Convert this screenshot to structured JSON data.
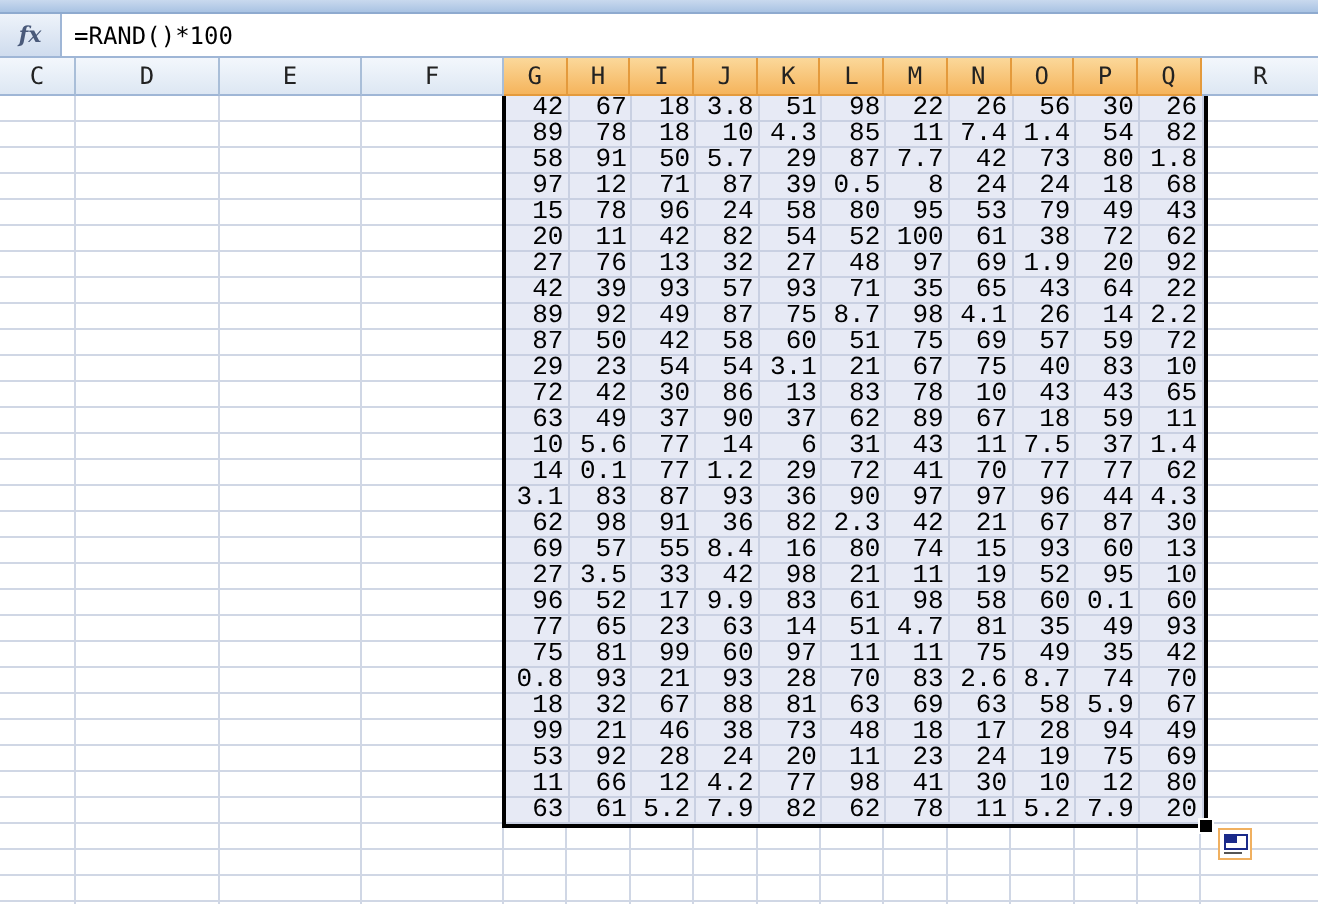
{
  "formula_bar": {
    "function_label": "fx",
    "formula": "=RAND()*100"
  },
  "columns": [
    {
      "label": "C",
      "selected": false
    },
    {
      "label": "D",
      "selected": false
    },
    {
      "label": "E",
      "selected": false
    },
    {
      "label": "F",
      "selected": false
    },
    {
      "label": "G",
      "selected": true
    },
    {
      "label": "H",
      "selected": true
    },
    {
      "label": "I",
      "selected": true
    },
    {
      "label": "J",
      "selected": true
    },
    {
      "label": "K",
      "selected": true
    },
    {
      "label": "L",
      "selected": true
    },
    {
      "label": "M",
      "selected": true
    },
    {
      "label": "N",
      "selected": true
    },
    {
      "label": "O",
      "selected": true
    },
    {
      "label": "P",
      "selected": true
    },
    {
      "label": "Q",
      "selected": true
    },
    {
      "label": "R",
      "selected": false
    }
  ],
  "rows": [
    [
      "42",
      "67",
      "18",
      "3.8",
      "51",
      "98",
      "22",
      "26",
      "56",
      "30",
      "26"
    ],
    [
      "89",
      "78",
      "18",
      "10",
      "4.3",
      "85",
      "11",
      "7.4",
      "1.4",
      "54",
      "82"
    ],
    [
      "58",
      "91",
      "50",
      "5.7",
      "29",
      "87",
      "7.7",
      "42",
      "73",
      "80",
      "1.8"
    ],
    [
      "97",
      "12",
      "71",
      "87",
      "39",
      "0.5",
      "8",
      "24",
      "24",
      "18",
      "68"
    ],
    [
      "15",
      "78",
      "96",
      "24",
      "58",
      "80",
      "95",
      "53",
      "79",
      "49",
      "43"
    ],
    [
      "20",
      "11",
      "42",
      "82",
      "54",
      "52",
      "100",
      "61",
      "38",
      "72",
      "62"
    ],
    [
      "27",
      "76",
      "13",
      "32",
      "27",
      "48",
      "97",
      "69",
      "1.9",
      "20",
      "92"
    ],
    [
      "42",
      "39",
      "93",
      "57",
      "93",
      "71",
      "35",
      "65",
      "43",
      "64",
      "22"
    ],
    [
      "89",
      "92",
      "49",
      "87",
      "75",
      "8.7",
      "98",
      "4.1",
      "26",
      "14",
      "2.2"
    ],
    [
      "87",
      "50",
      "42",
      "58",
      "60",
      "51",
      "75",
      "69",
      "57",
      "59",
      "72"
    ],
    [
      "29",
      "23",
      "54",
      "54",
      "3.1",
      "21",
      "67",
      "75",
      "40",
      "83",
      "10"
    ],
    [
      "72",
      "42",
      "30",
      "86",
      "13",
      "83",
      "78",
      "10",
      "43",
      "43",
      "65"
    ],
    [
      "63",
      "49",
      "37",
      "90",
      "37",
      "62",
      "89",
      "67",
      "18",
      "59",
      "11"
    ],
    [
      "10",
      "5.6",
      "77",
      "14",
      "6",
      "31",
      "43",
      "11",
      "7.5",
      "37",
      "1.4"
    ],
    [
      "14",
      "0.1",
      "77",
      "1.2",
      "29",
      "72",
      "41",
      "70",
      "77",
      "77",
      "62"
    ],
    [
      "3.1",
      "83",
      "87",
      "93",
      "36",
      "90",
      "97",
      "97",
      "96",
      "44",
      "4.3"
    ],
    [
      "62",
      "98",
      "91",
      "36",
      "82",
      "2.3",
      "42",
      "21",
      "67",
      "87",
      "30"
    ],
    [
      "69",
      "57",
      "55",
      "8.4",
      "16",
      "80",
      "74",
      "15",
      "93",
      "60",
      "13"
    ],
    [
      "27",
      "3.5",
      "33",
      "42",
      "98",
      "21",
      "11",
      "19",
      "52",
      "95",
      "10"
    ],
    [
      "96",
      "52",
      "17",
      "9.9",
      "83",
      "61",
      "98",
      "58",
      "60",
      "0.1",
      "60"
    ],
    [
      "77",
      "65",
      "23",
      "63",
      "14",
      "51",
      "4.7",
      "81",
      "35",
      "49",
      "93"
    ],
    [
      "75",
      "81",
      "99",
      "60",
      "97",
      "11",
      "11",
      "75",
      "49",
      "35",
      "42"
    ],
    [
      "0.8",
      "93",
      "21",
      "93",
      "28",
      "70",
      "83",
      "2.6",
      "8.7",
      "74",
      "70"
    ],
    [
      "18",
      "32",
      "67",
      "88",
      "81",
      "63",
      "69",
      "63",
      "58",
      "5.9",
      "67"
    ],
    [
      "99",
      "21",
      "46",
      "38",
      "73",
      "48",
      "18",
      "17",
      "28",
      "94",
      "49"
    ],
    [
      "53",
      "92",
      "28",
      "24",
      "20",
      "11",
      "23",
      "24",
      "19",
      "75",
      "69"
    ],
    [
      "11",
      "66",
      "12",
      "4.2",
      "77",
      "98",
      "41",
      "30",
      "10",
      "12",
      "80"
    ],
    [
      "63",
      "61",
      "5.2",
      "7.9",
      "82",
      "62",
      "78",
      "11",
      "5.2",
      "7.9",
      "20"
    ]
  ]
}
